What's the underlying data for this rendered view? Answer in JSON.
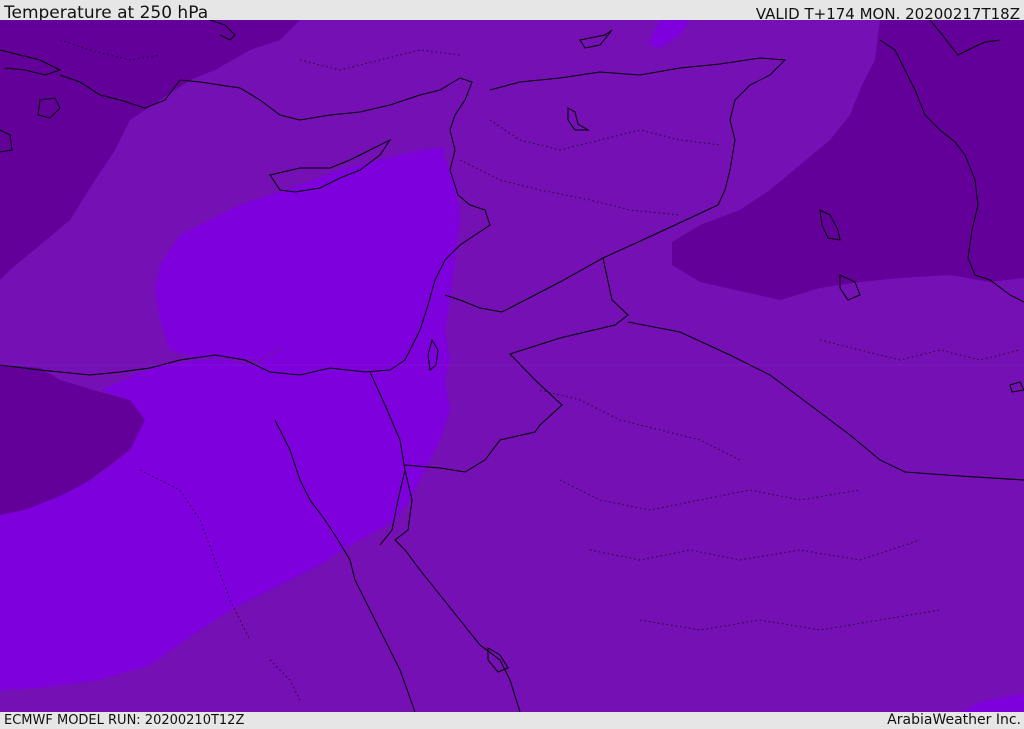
{
  "header": {
    "title": "Temperature at 250 hPa",
    "valid": "VALID T+174 MON. 20200217T18Z"
  },
  "footer": {
    "model_run": "ECMWF MODEL RUN: 20200210T12Z",
    "credit": "ArabiaWeather Inc."
  },
  "colors": {
    "band_coldest": "#63009a",
    "band_mid": "#7410b4",
    "band_warm": "#7e00dc",
    "coastline": "#000000",
    "background": "#e6e6e6"
  }
}
